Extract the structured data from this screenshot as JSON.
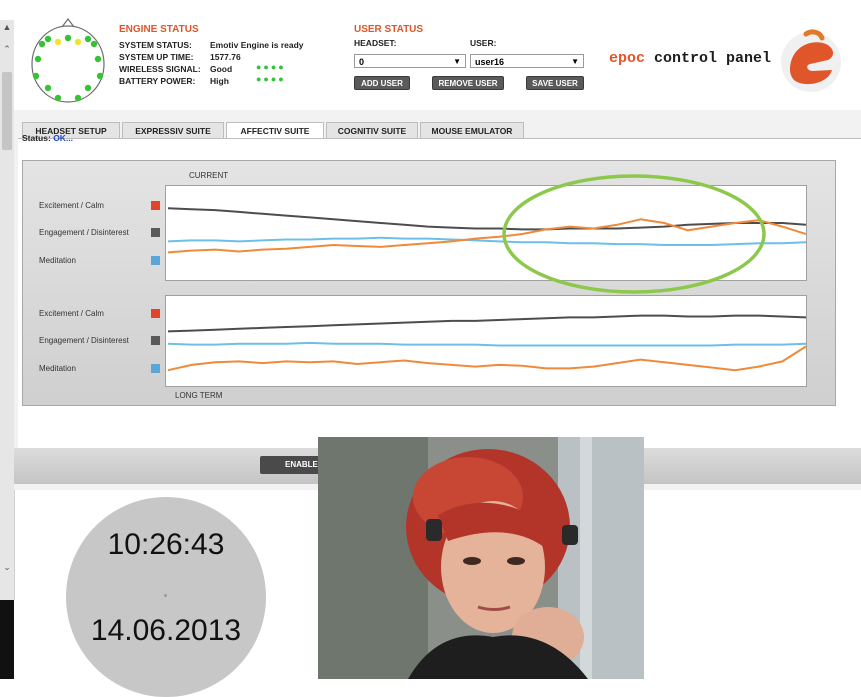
{
  "engine_status": {
    "title": "ENGINE STATUS",
    "system_status_label": "SYSTEM STATUS:",
    "system_status_value": "Emotiv Engine is ready",
    "uptime_label": "SYSTEM UP TIME:",
    "uptime_value": "1577.76",
    "wireless_label": "WIRELESS SIGNAL:",
    "wireless_value": "Good",
    "battery_label": "BATTERY POWER:",
    "battery_value": "High",
    "indicator_dots": "●●●●"
  },
  "user_status": {
    "title": "USER STATUS",
    "headset_label": "HEADSET:",
    "headset_value": "0",
    "user_label": "USER:",
    "user_value": "user16",
    "add_user": "ADD USER",
    "remove_user": "REMOVE USER",
    "save_user": "SAVE USER"
  },
  "brand": {
    "prefix": "epoc",
    "rest": " control panel"
  },
  "tabs": [
    {
      "label": "HEADSET SETUP"
    },
    {
      "label": "EXPRESSIV SUITE"
    },
    {
      "label": "AFFECTIV SUITE",
      "active": true
    },
    {
      "label": "COGNITIV SUITE"
    },
    {
      "label": "MOUSE EMULATOR"
    }
  ],
  "status": {
    "label": "Status:",
    "value": "OK..."
  },
  "chart_panel": {
    "current_label": "CURRENT",
    "long_term_label": "LONG TERM",
    "legend": [
      {
        "label": "Excitement / Calm",
        "color": "#e0452a"
      },
      {
        "label": "Engagement / Disinterest",
        "color": "#5a5a5a"
      },
      {
        "label": "Meditation",
        "color": "#5aa6d8"
      }
    ]
  },
  "chart_data": [
    {
      "type": "line",
      "title": "CURRENT",
      "ylim": [
        0,
        1
      ],
      "series": [
        {
          "name": "Engagement / Disinterest",
          "color": "#4d4d4d",
          "values": [
            0.78,
            0.77,
            0.76,
            0.74,
            0.72,
            0.7,
            0.68,
            0.66,
            0.64,
            0.62,
            0.6,
            0.58,
            0.57,
            0.56,
            0.56,
            0.55,
            0.55,
            0.56,
            0.56,
            0.56,
            0.57,
            0.58,
            0.6,
            0.61,
            0.62,
            0.62,
            0.62,
            0.6
          ]
        },
        {
          "name": "Meditation",
          "color": "#6cc0e8",
          "values": [
            0.42,
            0.43,
            0.43,
            0.42,
            0.43,
            0.44,
            0.44,
            0.45,
            0.45,
            0.46,
            0.45,
            0.45,
            0.44,
            0.43,
            0.42,
            0.41,
            0.41,
            0.4,
            0.4,
            0.39,
            0.39,
            0.38,
            0.38,
            0.38,
            0.39,
            0.4,
            0.4,
            0.41
          ]
        },
        {
          "name": "Excitement / Calm",
          "color": "#f08a3a",
          "values": [
            0.3,
            0.32,
            0.33,
            0.31,
            0.33,
            0.34,
            0.36,
            0.38,
            0.37,
            0.36,
            0.38,
            0.4,
            0.42,
            0.45,
            0.47,
            0.5,
            0.55,
            0.58,
            0.56,
            0.6,
            0.66,
            0.62,
            0.54,
            0.58,
            0.62,
            0.65,
            0.58,
            0.5
          ]
        }
      ]
    },
    {
      "type": "line",
      "title": "LONG TERM",
      "ylim": [
        0,
        1
      ],
      "series": [
        {
          "name": "Engagement / Disinterest",
          "color": "#4d4d4d",
          "values": [
            0.62,
            0.63,
            0.64,
            0.65,
            0.66,
            0.67,
            0.68,
            0.69,
            0.7,
            0.71,
            0.72,
            0.73,
            0.74,
            0.74,
            0.75,
            0.76,
            0.77,
            0.78,
            0.78,
            0.79,
            0.8,
            0.8,
            0.79,
            0.79,
            0.8,
            0.8,
            0.79,
            0.78
          ]
        },
        {
          "name": "Meditation",
          "color": "#6cc0e8",
          "values": [
            0.48,
            0.47,
            0.47,
            0.48,
            0.48,
            0.48,
            0.49,
            0.48,
            0.48,
            0.48,
            0.47,
            0.47,
            0.47,
            0.47,
            0.46,
            0.46,
            0.46,
            0.46,
            0.46,
            0.46,
            0.46,
            0.46,
            0.46,
            0.46,
            0.47,
            0.47,
            0.47,
            0.48
          ]
        },
        {
          "name": "Excitement / Calm",
          "color": "#f08a3a",
          "values": [
            0.18,
            0.24,
            0.27,
            0.28,
            0.26,
            0.28,
            0.27,
            0.28,
            0.25,
            0.27,
            0.29,
            0.26,
            0.24,
            0.22,
            0.24,
            0.23,
            0.2,
            0.2,
            0.22,
            0.26,
            0.3,
            0.27,
            0.24,
            0.21,
            0.18,
            0.22,
            0.28,
            0.45
          ]
        }
      ]
    }
  ],
  "fullscreen_button": "ENABLE FULLSCREEN",
  "clock": {
    "time": "10:26:43",
    "date": "14.06.2013"
  },
  "colors": {
    "accent": "#e0552a",
    "highlight_ring": "#8cc84b",
    "ok": "#1f47c8"
  }
}
